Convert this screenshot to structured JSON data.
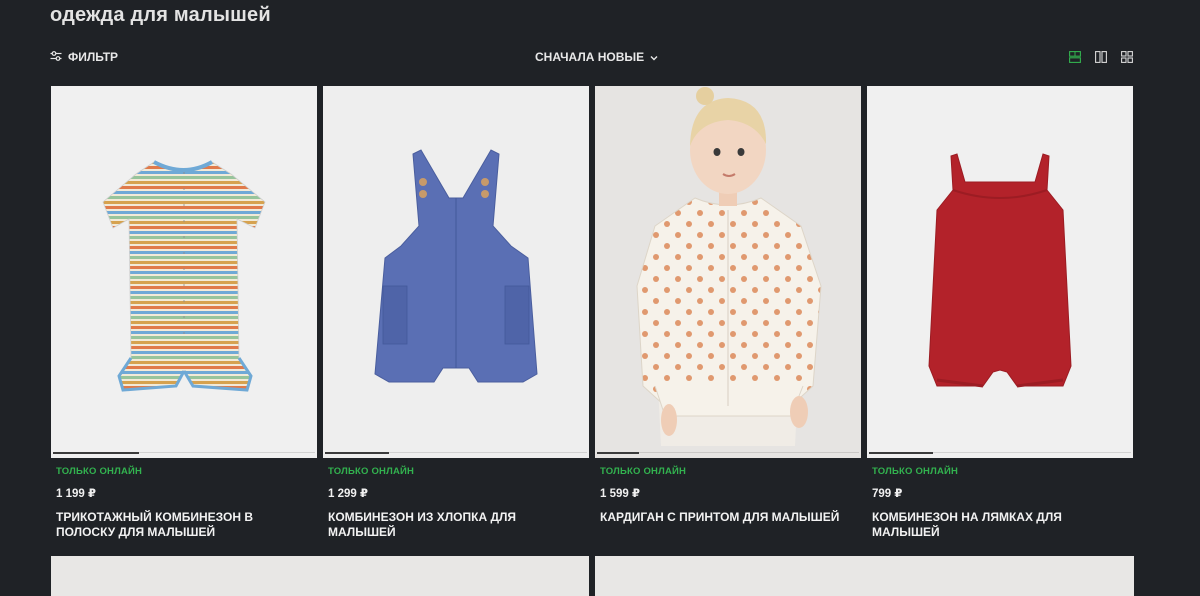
{
  "page": {
    "title": "одежда для малышей"
  },
  "toolbar": {
    "filter_label": "ФИЛЬТР",
    "filter_icon": "sliders-icon",
    "sort_label": "СНАЧАЛА НОВЫЕ",
    "sort_icon": "chevron-down-icon",
    "view_options": [
      {
        "icon": "view-large-icon",
        "active": true
      },
      {
        "icon": "view-two-columns-icon",
        "active": false
      },
      {
        "icon": "view-grid-icon",
        "active": false
      }
    ],
    "accent_color": "#32b24f"
  },
  "products": [
    {
      "badge": "ТОЛЬКО ОНЛАЙН",
      "price": "1 199 ₽",
      "name": "ТРИКОТАЖНЫЙ КОМБИНЕЗОН В ПОЛОСКУ ДЛЯ МАЛЫШЕЙ",
      "image": "striped-romper"
    },
    {
      "badge": "ТОЛЬКО ОНЛАЙН",
      "price": "1 299 ₽",
      "name": "КОМБИНЕЗОН ИЗ ХЛОПКА ДЛЯ МАЛЫШЕЙ",
      "image": "blue-overalls"
    },
    {
      "badge": "ТОЛЬКО ОНЛАЙН",
      "price": "1 599 ₽",
      "name": "КАРДИГАН С ПРИНТОМ ДЛЯ МАЛЫШЕЙ",
      "image": "girl-in-cardigan"
    },
    {
      "badge": "ТОЛЬКО ОНЛАЙН",
      "price": "799 ₽",
      "name": "КОМБИНЕЗОН НА ЛЯМКАХ ДЛЯ МАЛЫШЕЙ",
      "image": "red-romper"
    }
  ],
  "colors": {
    "background": "#1f2226",
    "badge": "#32b24f",
    "image_background": "#f0f0f0"
  }
}
